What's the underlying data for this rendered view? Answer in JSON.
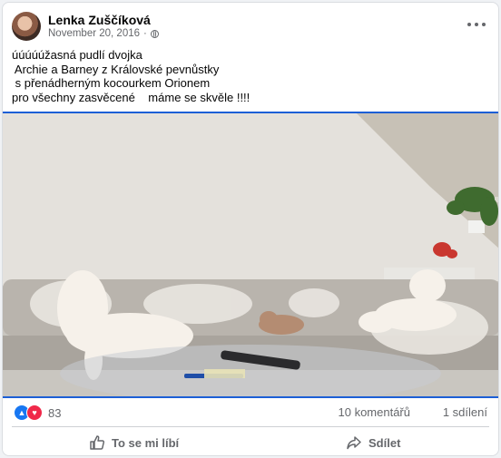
{
  "post": {
    "author": "Lenka Zuščíková",
    "date": "November 20, 2016",
    "separator": "·",
    "text": "úúúúúžasná pudlí dvojka\n Archie a Barney z Královské pevnůstky\n s přenádherným kocourkem Orionem\npro všechny zasvěcené    máme se skvěle !!!!"
  },
  "stats": {
    "reaction_count": "83",
    "comments": "10 komentářů",
    "shares": "1 sdílení"
  },
  "actions": {
    "like_label": "To se mi líbí",
    "share_label": "Sdílet"
  },
  "icons": {
    "globe": "globe-icon",
    "more": "more-options-icon",
    "like": "like-icon",
    "share": "share-icon"
  },
  "colors": {
    "link_blue": "#1877f2",
    "love_red": "#f02849",
    "photo_border": "#1c5fd6"
  }
}
